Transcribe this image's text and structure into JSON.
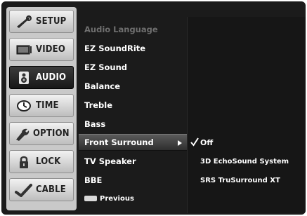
{
  "tabs": [
    {
      "label": "SETUP",
      "icon": "wrench-icon",
      "active": false
    },
    {
      "label": "VIDEO",
      "icon": "tv-icon",
      "active": false
    },
    {
      "label": "AUDIO",
      "icon": "speaker-icon",
      "active": true
    },
    {
      "label": "TIME",
      "icon": "clock-icon",
      "active": false
    },
    {
      "label": "OPTION",
      "icon": "option-icon",
      "active": false
    },
    {
      "label": "LOCK",
      "icon": "lock-icon",
      "active": false
    },
    {
      "label": "CABLE",
      "icon": "cable-icon",
      "active": false
    }
  ],
  "menu": {
    "items": [
      {
        "label": "Audio Language",
        "state": "disabled"
      },
      {
        "label": "EZ SoundRite",
        "state": "normal"
      },
      {
        "label": "EZ Sound",
        "state": "normal"
      },
      {
        "label": "Balance",
        "state": "normal"
      },
      {
        "label": "Treble",
        "state": "normal"
      },
      {
        "label": "Bass",
        "state": "normal"
      },
      {
        "label": "Front Surround",
        "state": "selected"
      },
      {
        "label": "TV Speaker",
        "state": "normal"
      },
      {
        "label": "BBE",
        "state": "normal"
      }
    ],
    "previous_label": "Previous"
  },
  "submenu": {
    "options": [
      {
        "label": "Off",
        "checked": true
      },
      {
        "label": "3D EchoSound System",
        "checked": false
      },
      {
        "label": "SRS TruSurround XT",
        "checked": false
      }
    ]
  },
  "colors": {
    "accent": "#5a5a5a",
    "panel": "#1b1b1b",
    "tab_bg": "#c9c9c9"
  }
}
